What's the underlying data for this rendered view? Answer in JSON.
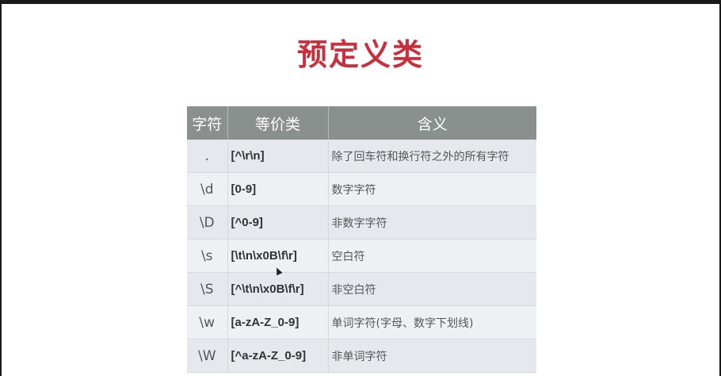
{
  "title": "预定义类",
  "table": {
    "headers": [
      "字符",
      "等价类",
      "含义"
    ],
    "rows": [
      {
        "char": ".",
        "equiv": "[^\\r\\n]",
        "meaning": "除了回车符和换行符之外的所有字符"
      },
      {
        "char": "\\d",
        "equiv": "[0-9]",
        "meaning": "数字字符"
      },
      {
        "char": "\\D",
        "equiv": "[^0-9]",
        "meaning": "非数字字符"
      },
      {
        "char": "\\s",
        "equiv": "[\\t\\n\\x0B\\f\\r]",
        "meaning": "空白符"
      },
      {
        "char": "\\S",
        "equiv": "[^\\t\\n\\x0B\\f\\r]",
        "meaning": "非空白符"
      },
      {
        "char": "\\w",
        "equiv": "[a-zA-Z_0-9]",
        "meaning": "单词字符(字母、数字下划线)"
      },
      {
        "char": "\\W",
        "equiv": "[^a-zA-Z_0-9]",
        "meaning": "非单词字符"
      }
    ]
  },
  "colors": {
    "title": "#c8303e",
    "header_bg": "#8a908e",
    "row_bg": "#e6e8ee"
  }
}
